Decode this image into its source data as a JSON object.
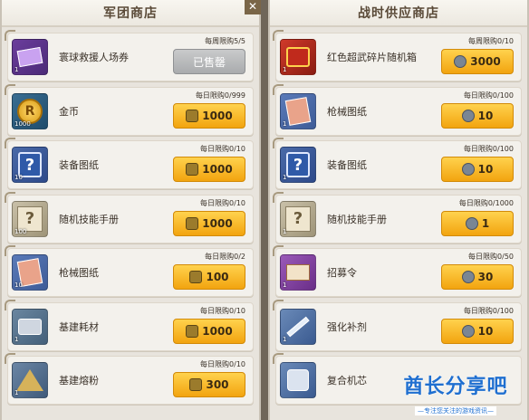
{
  "left_panel": {
    "title": "军团商店",
    "items": [
      {
        "name": "寰球救援人场券",
        "limit": "每周限购5/5",
        "price": "已售罄",
        "sold_out": true,
        "qty": "1",
        "icon": "ticket-icon",
        "theme": "t-ticket"
      },
      {
        "name": "金币",
        "limit": "每日限购0/999",
        "price": "1000",
        "sold_out": false,
        "qty": "1000",
        "icon": "coin-icon",
        "theme": "t-coin"
      },
      {
        "name": "装备图纸",
        "limit": "每日限购0/10",
        "price": "1000",
        "sold_out": false,
        "qty": "10",
        "icon": "blueprint-icon",
        "theme": "t-blue"
      },
      {
        "name": "随机技能手册",
        "limit": "每日限购0/10",
        "price": "1000",
        "sold_out": false,
        "qty": "100",
        "icon": "skill-manual-icon",
        "theme": "t-paper"
      },
      {
        "name": "枪械图纸",
        "limit": "每日限购0/2",
        "price": "100",
        "sold_out": false,
        "qty": "10",
        "icon": "gun-blueprint-icon",
        "theme": "t-gun"
      },
      {
        "name": "基建耗材",
        "limit": "每日限购0/10",
        "price": "1000",
        "sold_out": false,
        "qty": "1",
        "icon": "material-icon",
        "theme": "t-mat"
      },
      {
        "name": "基建熔粉",
        "limit": "每日限购0/10",
        "price": "300",
        "sold_out": false,
        "qty": "1",
        "icon": "powder-icon",
        "theme": "t-powder"
      }
    ]
  },
  "right_panel": {
    "title": "战时供应商店",
    "items": [
      {
        "name": "红色超武碎片随机箱",
        "limit": "每周限购0/10",
        "price": "3000",
        "qty": "1",
        "icon": "red-box-icon",
        "theme": "t-red"
      },
      {
        "name": "枪械图纸",
        "limit": "每日限购0/100",
        "price": "10",
        "qty": "1",
        "icon": "gun-blueprint-icon",
        "theme": "t-gun"
      },
      {
        "name": "装备图纸",
        "limit": "每日限购0/100",
        "price": "10",
        "qty": "1",
        "icon": "blueprint-icon",
        "theme": "t-blue"
      },
      {
        "name": "随机技能手册",
        "limit": "每日限购0/1000",
        "price": "1",
        "qty": "1",
        "icon": "skill-manual-icon",
        "theme": "t-paper"
      },
      {
        "name": "招募令",
        "limit": "每日限购0/50",
        "price": "30",
        "qty": "1",
        "icon": "recruit-order-icon",
        "theme": "t-purple"
      },
      {
        "name": "强化补剂",
        "limit": "每日限购0/100",
        "price": "10",
        "qty": "1",
        "icon": "syringe-icon",
        "theme": "t-chip"
      },
      {
        "name": "复合机芯",
        "limit": "",
        "price": "",
        "qty": "",
        "icon": "chip-core-icon",
        "theme": "t-chip"
      }
    ]
  },
  "watermark": {
    "main": "酋长分享吧",
    "sub": "—专注您关注的游戏资讯—"
  }
}
